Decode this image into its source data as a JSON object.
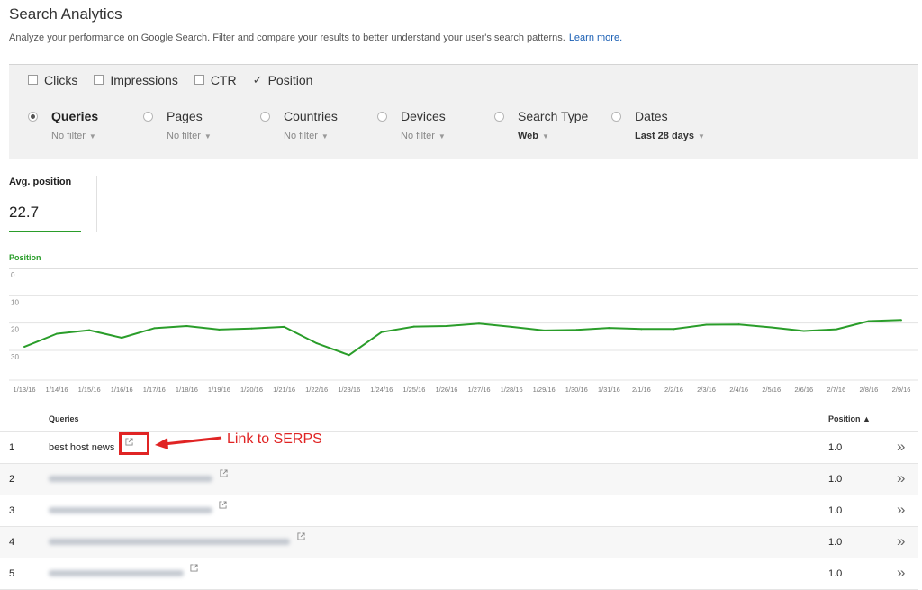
{
  "header": {
    "title": "Search Analytics",
    "subtitle": "Analyze your performance on Google Search. Filter and compare your results to better understand your user's search patterns.",
    "learn_more": "Learn more."
  },
  "metrics": [
    {
      "label": "Clicks",
      "checked": false
    },
    {
      "label": "Impressions",
      "checked": false
    },
    {
      "label": "CTR",
      "checked": false
    },
    {
      "label": "Position",
      "checked": true
    }
  ],
  "groups": [
    {
      "label": "Queries",
      "filter": "No filter",
      "selected": true
    },
    {
      "label": "Pages",
      "filter": "No filter",
      "selected": false
    },
    {
      "label": "Countries",
      "filter": "No filter",
      "selected": false
    },
    {
      "label": "Devices",
      "filter": "No filter",
      "selected": false
    },
    {
      "label": "Search Type",
      "filter": "Web",
      "selected": false
    },
    {
      "label": "Dates",
      "filter": "Last 28 days",
      "selected": false
    }
  ],
  "summary": {
    "label": "Avg. position",
    "value": "22.7"
  },
  "chart_data": {
    "type": "line",
    "title": "Position",
    "color": "#2a9d2a",
    "ylim": [
      0,
      30
    ],
    "yticks": [
      "0",
      "10",
      "20",
      "30"
    ],
    "y_inverted": true,
    "x": [
      "1/13/16",
      "1/14/16",
      "1/15/16",
      "1/16/16",
      "1/17/16",
      "1/18/16",
      "1/19/16",
      "1/20/16",
      "1/21/16",
      "1/22/16",
      "1/23/16",
      "1/24/16",
      "1/25/16",
      "1/26/16",
      "1/27/16",
      "1/28/16",
      "1/29/16",
      "1/30/16",
      "1/31/16",
      "2/1/16",
      "2/2/16",
      "2/3/16",
      "2/4/16",
      "2/5/16",
      "2/6/16",
      "2/7/16",
      "2/8/16",
      "2/9/16"
    ],
    "values": [
      28.7,
      23.9,
      22.6,
      25.4,
      21.9,
      21.1,
      22.4,
      22.0,
      21.4,
      27.4,
      31.7,
      23.3,
      21.3,
      21.1,
      20.2,
      21.4,
      22.7,
      22.5,
      21.8,
      22.2,
      22.2,
      20.6,
      20.5,
      21.6,
      22.9,
      22.3,
      19.3,
      18.9
    ]
  },
  "table": {
    "col_queries": "Queries",
    "col_position": "Position ▲",
    "rows": [
      {
        "num": "1",
        "query": "best host news",
        "position": "1.0"
      },
      {
        "num": "2",
        "query": "",
        "position": "1.0"
      },
      {
        "num": "3",
        "query": "",
        "position": "1.0"
      },
      {
        "num": "4",
        "query": "",
        "position": "1.0"
      },
      {
        "num": "5",
        "query": "",
        "position": "1.0"
      }
    ]
  },
  "annotation": {
    "callout": "Link to SERPS",
    "color": "#e02424"
  }
}
